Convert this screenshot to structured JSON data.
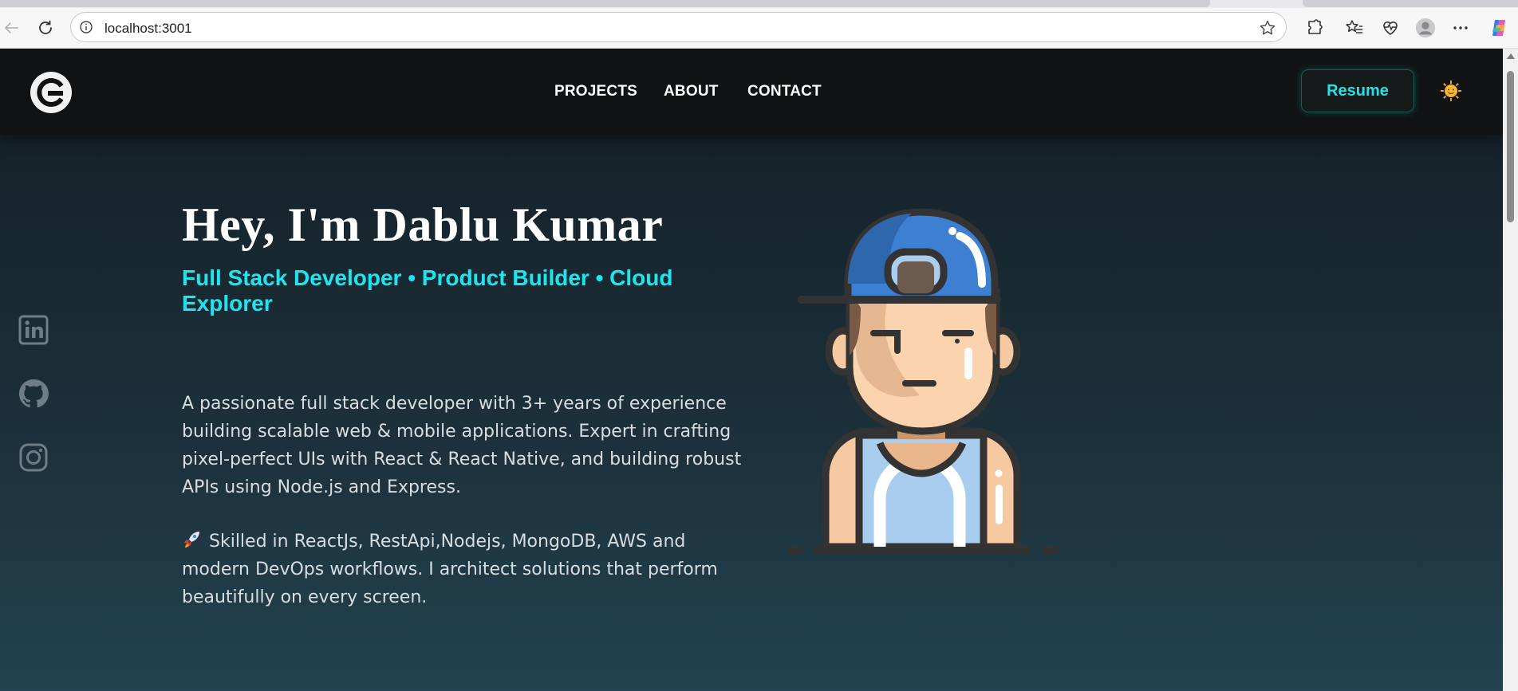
{
  "browser": {
    "url": "localhost:3001",
    "icons": [
      "back-icon",
      "reload-icon",
      "site-info-icon",
      "favorite-star-icon",
      "extensions-icon",
      "favorites-icon",
      "browser-essentials-icon",
      "profile-icon",
      "more-icon",
      "copilot-icon"
    ]
  },
  "header": {
    "nav": [
      "PROJECTS",
      "ABOUT",
      "CONTACT"
    ],
    "resume_label": "Resume",
    "accent": "#22e3e8"
  },
  "socials": [
    "linkedin-icon",
    "github-icon",
    "instagram-icon"
  ],
  "hero": {
    "title": "Hey, I'm Dablu Kumar",
    "subtitle": "Full Stack Developer • Product Builder • Cloud Explorer",
    "para1": "A passionate full stack developer with 3+ years of experience building scalable web & mobile applications. Expert in crafting pixel-perfect UIs with React & React Native, and building robust APIs using Node.js and Express.",
    "para2": "Skilled in ReactJs, RestApi,Nodejs, MongoDB, AWS and modern DevOps workflows. I architect solutions that perform beautifully on every screen."
  },
  "colors": {
    "subtitle": "#1ce6ef",
    "header_bg": "#111213"
  }
}
